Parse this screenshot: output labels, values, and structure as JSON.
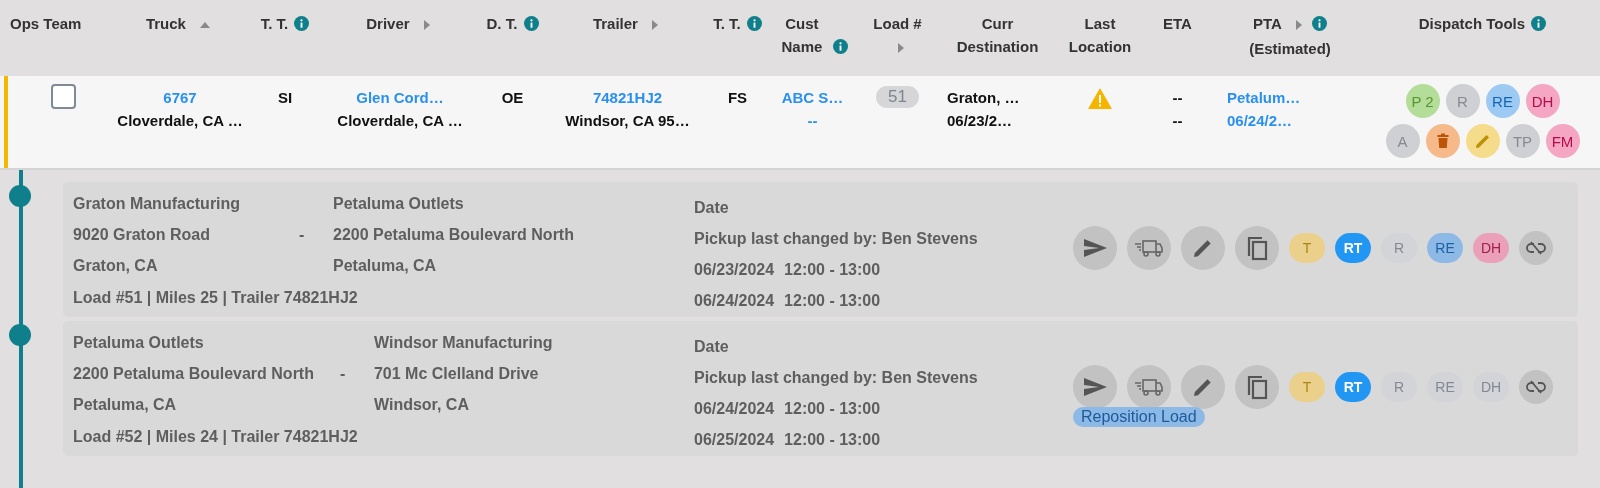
{
  "columns": [
    {
      "label": "Ops Team"
    },
    {
      "label": "Truck",
      "sortable": true,
      "sorted": true
    },
    {
      "label": "T. T.",
      "info": true
    },
    {
      "label": "Driver",
      "sortable": true
    },
    {
      "label": "D. T.",
      "info": true
    },
    {
      "label": "Trailer",
      "sortable": true
    },
    {
      "label": "T. T.",
      "info": true
    },
    {
      "label": "Cust Name",
      "info": true
    },
    {
      "label": "Load #",
      "sortable": true
    },
    {
      "label": "Curr Destination"
    },
    {
      "label": "Last Location"
    },
    {
      "label": "ETA"
    },
    {
      "label": "PTA",
      "sortable": true,
      "info": true,
      "note": "(Estimated)"
    },
    {
      "label": "Dispatch Tools",
      "info": true
    }
  ],
  "row": {
    "flagged": true,
    "cells": [
      {
        "kind": "checkbox",
        "checked": false
      },
      {
        "kind": "stack",
        "lines": [
          {
            "text": "6767",
            "link": true
          },
          {
            "text": "Cloverdale, CA …",
            "link": false
          }
        ]
      },
      {
        "kind": "stack",
        "lines": [
          {
            "text": "SI",
            "link": false
          }
        ]
      },
      {
        "kind": "stack",
        "lines": [
          {
            "text": "Glen Cord…",
            "link": true
          },
          {
            "text": "Cloverdale, CA …",
            "link": false
          }
        ]
      },
      {
        "kind": "stack",
        "lines": [
          {
            "text": "OE",
            "link": false
          }
        ]
      },
      {
        "kind": "stack",
        "lines": [
          {
            "text": "74821HJ2",
            "link": true
          },
          {
            "text": "Windsor, CA 95…",
            "link": false
          }
        ]
      },
      {
        "kind": "stack",
        "lines": [
          {
            "text": "FS",
            "link": false
          }
        ]
      },
      {
        "kind": "stack",
        "lines": [
          {
            "text": "ABC S…",
            "link": true
          },
          {
            "text": "--",
            "link": true
          }
        ]
      },
      {
        "kind": "count",
        "text": "51"
      },
      {
        "kind": "stack",
        "left_aligned": true,
        "lines": [
          {
            "text": "Graton, …",
            "link": false
          },
          {
            "text": "06/23/2…",
            "link": false
          }
        ]
      },
      {
        "kind": "warning"
      },
      {
        "kind": "stack",
        "lines": [
          {
            "text": "--",
            "link": false
          },
          {
            "text": "--",
            "link": false
          }
        ]
      },
      {
        "kind": "stack",
        "left_aligned": true,
        "lines": [
          {
            "text": "Petalum…",
            "link": true
          },
          {
            "text": "06/24/2…",
            "link": true
          }
        ]
      },
      {
        "kind": "tools",
        "tools": [
          {
            "kind": "text",
            "label": "P 2",
            "color": "#b5dd9a"
          },
          {
            "kind": "text",
            "label": "R",
            "color": "#cfd0d3"
          },
          {
            "kind": "text",
            "label": "RE",
            "color": "#9ccaf2"
          },
          {
            "kind": "text",
            "label": "DH",
            "color": "#f4a6c3"
          },
          {
            "kind": "text",
            "label": "A",
            "color": "#cfd0d3"
          },
          {
            "kind": "delete",
            "color": "#f5b98a"
          },
          {
            "kind": "edit",
            "color": "#f5dc8a"
          },
          {
            "kind": "text",
            "label": "TP",
            "color": "#cfd0d3"
          },
          {
            "kind": "text",
            "label": "FM",
            "color": "#f4a6c3"
          }
        ]
      }
    ]
  },
  "stops": [
    {
      "origin": {
        "name": "Graton Manufacturing",
        "address": "9020 Graton Road",
        "city": "Graton, CA"
      },
      "separator": "-",
      "destination": {
        "name": "Petaluma Outlets",
        "address": "2200 Petaluma Boulevard North",
        "city": "Petaluma, CA"
      },
      "summary": "Load #51 | Miles 25 | Trailer 74821HJ2",
      "date_label": "Date",
      "changed_by": "Pickup last changed by: Ben Stevens",
      "windows": [
        {
          "date": "06/23/2024",
          "time": "12:00 - 13:00"
        },
        {
          "date": "06/24/2024",
          "time": "12:00 - 13:00"
        }
      ],
      "badges": [
        {
          "label": "T",
          "color": "#ead08a",
          "selected": false
        },
        {
          "label": "RT",
          "color": "#2196f3",
          "selected": true
        },
        {
          "label": "R",
          "color": "#d3d4d8",
          "selected": false
        },
        {
          "label": "RE",
          "color": "#8db9e6",
          "selected": false
        },
        {
          "label": "DH",
          "color": "#e9a0b8",
          "selected": false
        }
      ]
    },
    {
      "origin": {
        "name": "Petaluma Outlets",
        "address": "2200 Petaluma Boulevard North",
        "city": "Petaluma, CA"
      },
      "separator": "-",
      "destination": {
        "name": "Windsor Manufacturing",
        "address": "701 Mc Clelland Drive",
        "city": "Windsor, CA"
      },
      "summary": "Load #52 | Miles 24 | Trailer 74821HJ2",
      "date_label": "Date",
      "changed_by": "Pickup last changed by: Ben Stevens",
      "windows": [
        {
          "date": "06/24/2024",
          "time": "12:00 - 13:00"
        },
        {
          "date": "06/25/2024",
          "time": "12:00 - 13:00"
        }
      ],
      "badges": [
        {
          "label": "T",
          "color": "#ead08a",
          "selected": false
        },
        {
          "label": "RT",
          "color": "#2196f3",
          "selected": true
        },
        {
          "label": "R",
          "color": "#d3d4d8",
          "selected": false
        },
        {
          "label": "RE",
          "color": "#d3d4d8",
          "selected": false
        },
        {
          "label": "DH",
          "color": "#d3d4d8",
          "selected": false
        }
      ],
      "tag": "Reposition Load"
    }
  ]
}
